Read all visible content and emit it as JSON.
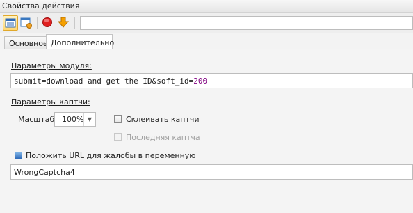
{
  "window": {
    "title": "Свойства действия"
  },
  "toolbar": {
    "buttons": [
      {
        "icon": "properties-icon",
        "active": true
      },
      {
        "icon": "settings-icon",
        "active": false
      },
      {
        "icon": "stop-icon",
        "active": false
      },
      {
        "icon": "arrow-down-icon",
        "active": false
      }
    ],
    "input_value": ""
  },
  "tabs": [
    {
      "label": "Основное",
      "selected": false
    },
    {
      "label": "Дополнительно",
      "selected": true
    }
  ],
  "module": {
    "section_label": "Параметры модуля:",
    "value_text": "submit=download and get the ID&soft_id=",
    "value_number": "200"
  },
  "captcha": {
    "section_label": "Параметры каптчи:",
    "scale_label": "Масштаб",
    "scale_value": "100%",
    "glue_label": "Склеивать каптчи",
    "glue_checked": false,
    "last_label": "Последняя каптча",
    "last_checked": false,
    "last_enabled": false
  },
  "complaint": {
    "checkbox_label": "Положить URL для жалобы в переменную",
    "checked": true,
    "variable_value": "WrongCaptcha4"
  },
  "colors": {
    "accent": "#e0a82a",
    "number": "#800080",
    "stop": "#e02020",
    "arrow": "#f5a000"
  }
}
